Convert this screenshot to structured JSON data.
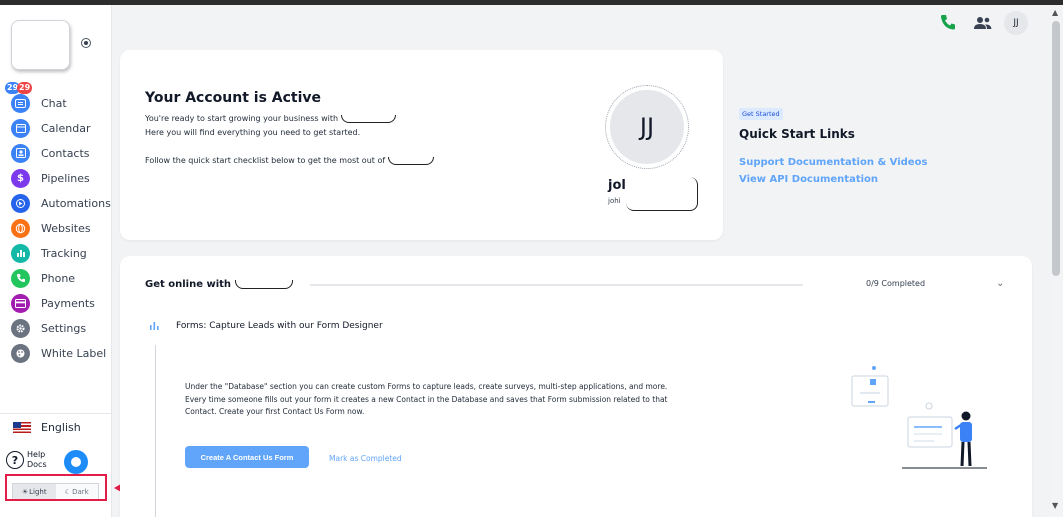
{
  "sidebar": {
    "items": [
      {
        "label": "Chat",
        "icon": "chat-icon",
        "color": "#3b82f6"
      },
      {
        "label": "Calendar",
        "icon": "calendar-icon",
        "color": "#3b82f6"
      },
      {
        "label": "Contacts",
        "icon": "contacts-icon",
        "color": "#3b82f6"
      },
      {
        "label": "Pipelines",
        "icon": "dollar-icon",
        "color": "#7c3aed"
      },
      {
        "label": "Automations",
        "icon": "automation-icon",
        "color": "#2563eb"
      },
      {
        "label": "Websites",
        "icon": "globe-icon",
        "color": "#f97316"
      },
      {
        "label": "Tracking",
        "icon": "chart-bars-icon",
        "color": "#14b8a6"
      },
      {
        "label": "Phone",
        "icon": "phone-icon",
        "color": "#22c55e"
      },
      {
        "label": "Payments",
        "icon": "card-icon",
        "color": "#a21caf"
      },
      {
        "label": "Settings",
        "icon": "gear-icon",
        "color": "#6b7280"
      },
      {
        "label": "White Label",
        "icon": "palette-icon",
        "color": "#6b7280"
      }
    ],
    "chat_badge_left": "29",
    "chat_badge_right": "29",
    "language": "English",
    "help_line1": "Help",
    "help_line2": "Docs",
    "help_glyph": "?",
    "theme_light": "Light",
    "theme_dark": "Dark",
    "theme_selected": "Light"
  },
  "header": {
    "avatar_initials": "JJ"
  },
  "account": {
    "title": "Your Account is Active",
    "line1": "You're ready to start growing your business with",
    "line2": "Here you will find everything you need to get started.",
    "line3": "Follow the quick start checklist below to get the most out of",
    "avatar_initials": "JJ",
    "name_partial": "jol",
    "email_partial": "johi"
  },
  "quick_start": {
    "badge": "Get Started",
    "title": "Quick Start Links",
    "link1": "Support Documentation & Videos",
    "link2": "View API Documentation"
  },
  "checklist": {
    "title": "Get online with",
    "progress": "0/9 Completed",
    "completed": 0,
    "total": 9,
    "task_title": "Forms: Capture Leads with our Form Designer",
    "task_description": "Under the \"Database\" section you can create custom Forms to capture leads, create surveys, multi-step applications, and more. Every time someone fills out your form it creates a new Contact in the Database and saves that Form submission related to that Contact. Create your first Contact Us Form now.",
    "primary_button": "Create A Contact Us Form",
    "secondary_button": "Mark as Completed"
  },
  "colors": {
    "accent": "#60a5fa",
    "highlight_box": "#e11d48",
    "phone_green": "#16a34a"
  }
}
